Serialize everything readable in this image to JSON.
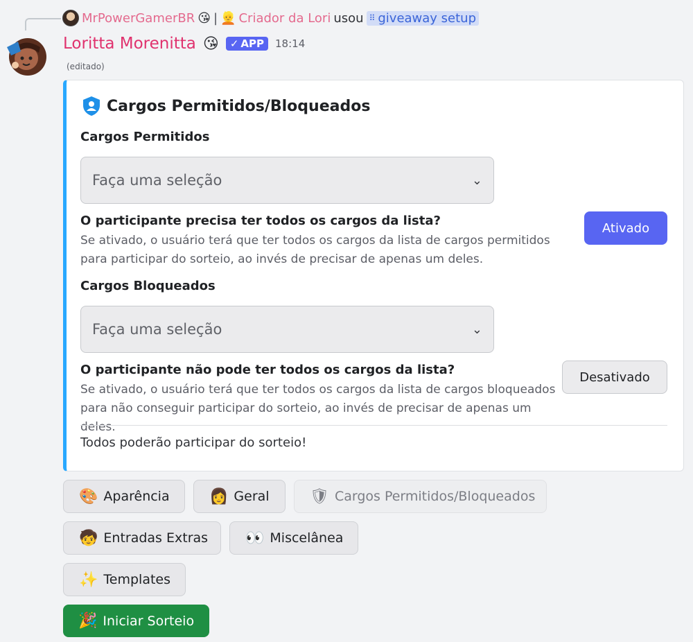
{
  "reply": {
    "user": "MrPowerGamerBR",
    "user_emoji": "😘",
    "separator": "|",
    "role_emoji": "👱",
    "role": "Criador da Lori",
    "verb": "usou",
    "command": "giveaway setup",
    "command_icon": "⠿"
  },
  "author": {
    "name": "Loritta Morenitta",
    "emoji": "😘",
    "badge": "APP",
    "badge_check": "✓",
    "time": "18:14",
    "edited": "(editado)"
  },
  "embed": {
    "accent": "#29a8ff",
    "title": "Cargos Permitidos/Bloqueados",
    "allowed_heading": "Cargos Permitidos",
    "allowed_select_placeholder": "Faça uma seleção",
    "require_all_title": "O participante precisa ter todos os cargos da lista?",
    "require_all_desc": "Se ativado, o usuário terá que ter todos os cargos da lista de cargos permitidos para participar do sorteio, ao invés de precisar de apenas um deles.",
    "require_all_button": "Ativado",
    "blocked_heading": "Cargos Bloqueados",
    "blocked_select_placeholder": "Faça uma seleção",
    "block_all_title": "O participante não pode ter todos os cargos da lista?",
    "block_all_desc": "Se ativado, o usuário terá que ter todos os cargos da lista de cargos bloqueados para não conseguir participar do sorteio, ao invés de precisar de apenas um deles.",
    "block_all_button": "Desativado",
    "footer": "Todos poderão participar do sorteio!"
  },
  "buttons": {
    "appearance": {
      "emoji": "🎨",
      "label": "Aparência"
    },
    "general": {
      "emoji": "👩",
      "label": "Geral"
    },
    "roles": {
      "emoji": "🛡",
      "label": "Cargos Permitidos/Bloqueados"
    },
    "extra_entries": {
      "emoji": "🧒",
      "label": "Entradas Extras"
    },
    "misc": {
      "emoji": "👀",
      "label": "Miscelânea"
    },
    "templates": {
      "emoji": "✨",
      "label": "Templates"
    },
    "start": {
      "emoji": "🎉",
      "label": "Iniciar Sorteio"
    }
  },
  "colors": {
    "primary_button": "#5865f2",
    "start_button": "#1f8f43",
    "author_name": "#e0326e"
  }
}
